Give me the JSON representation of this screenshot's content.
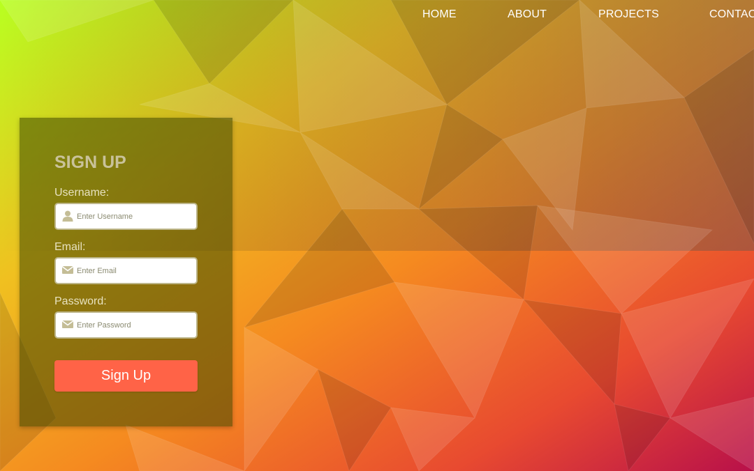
{
  "nav": {
    "items": [
      {
        "label": "HOME"
      },
      {
        "label": "ABOUT"
      },
      {
        "label": "PROJECTS"
      },
      {
        "label": "CONTACT"
      }
    ]
  },
  "signup": {
    "title": "SIGN UP",
    "username": {
      "label": "Username:",
      "placeholder": "Enter Username",
      "icon": "user-icon"
    },
    "email": {
      "label": "Email:",
      "placeholder": "Enter Email",
      "icon": "envelope-icon"
    },
    "password": {
      "label": "Password:",
      "placeholder": "Enter Password",
      "icon": "envelope-icon"
    },
    "submit_label": "Sign Up"
  },
  "colors": {
    "button": "#ff6347",
    "panel": "rgba(60,70,0,0.55)",
    "title": "#c9c29a"
  }
}
